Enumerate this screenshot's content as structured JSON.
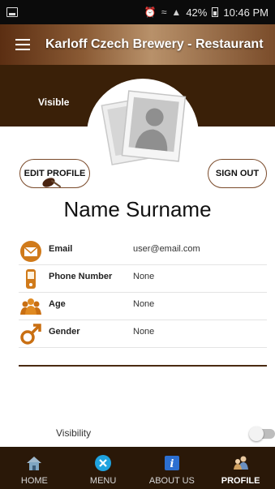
{
  "status_bar": {
    "battery": "42%",
    "time": "10:46 PM",
    "icons": [
      "screenshot-icon",
      "alarm-icon",
      "wifi-icon",
      "signal-icon",
      "battery-icon"
    ]
  },
  "app_bar": {
    "title": "Karloff Czech Brewery - Restaurant",
    "menu_icon": "hamburger-icon"
  },
  "profile": {
    "visibility_badge": "Visible",
    "edit_button": "EDIT PROFILE",
    "signout_button": "SIGN OUT",
    "name": "Name Surname",
    "fields": [
      {
        "label": "Email",
        "value": "user@email.com",
        "icon": "envelope-icon"
      },
      {
        "label": "Phone Number",
        "value": "None",
        "icon": "phone-icon"
      },
      {
        "label": "Age",
        "value": "None",
        "icon": "people-icon"
      },
      {
        "label": "Gender",
        "value": "None",
        "icon": "male-icon"
      }
    ],
    "visibility_label": "Visibility",
    "visibility_on": false
  },
  "bottom_nav": {
    "items": [
      {
        "label": "HOME",
        "icon": "home-icon"
      },
      {
        "label": "MENU",
        "icon": "close-circle-icon"
      },
      {
        "label": "ABOUT US",
        "icon": "info-icon"
      },
      {
        "label": "PROFILE",
        "icon": "user-icon"
      }
    ],
    "active": "PROFILE"
  },
  "colors": {
    "brand_dark": "#3a2008",
    "accent_brown": "#7a4a2a",
    "icon_orange": "#d07a1a",
    "nav_bg": "#2a1808"
  }
}
